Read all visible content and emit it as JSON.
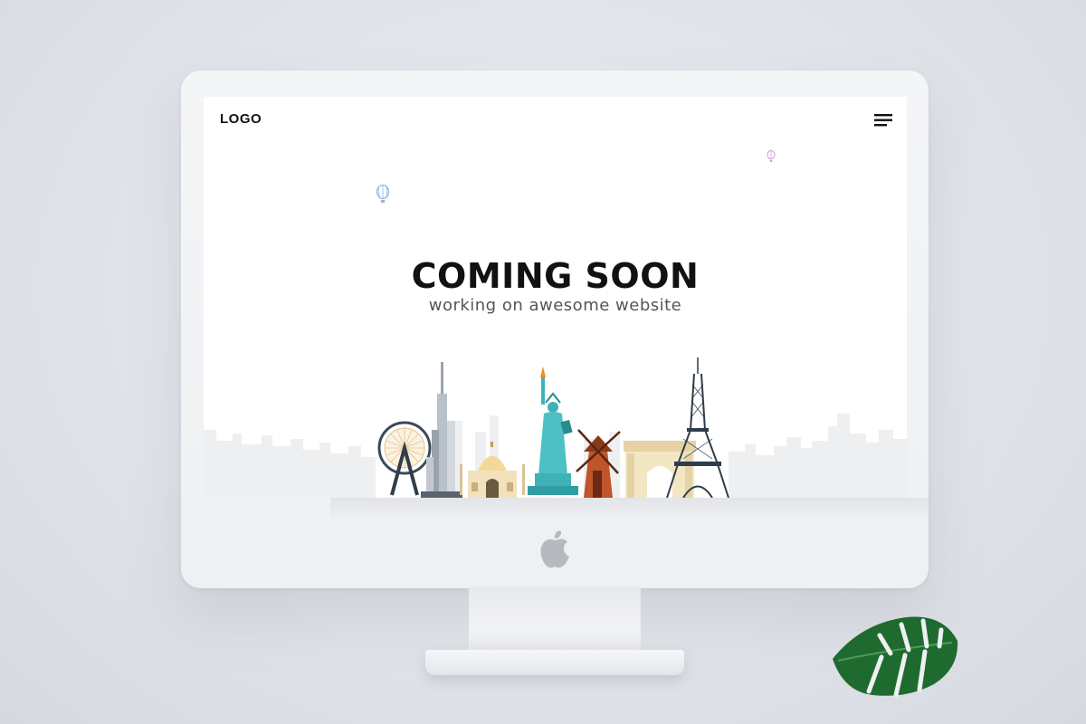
{
  "site": {
    "logo_text": "LOGO",
    "headline": "COMING SOON",
    "subline": "working on awesome website"
  },
  "icons": {
    "menu": "hamburger-menu-icon",
    "brand": "apple-logo-icon"
  },
  "colors": {
    "monitor_body": "#eef0f3",
    "screen_bg": "#ffffff",
    "headline_text": "#111111",
    "subline_text": "#555555",
    "statue_teal": "#3fb2b7",
    "leaf_green": "#1f6b2f"
  }
}
